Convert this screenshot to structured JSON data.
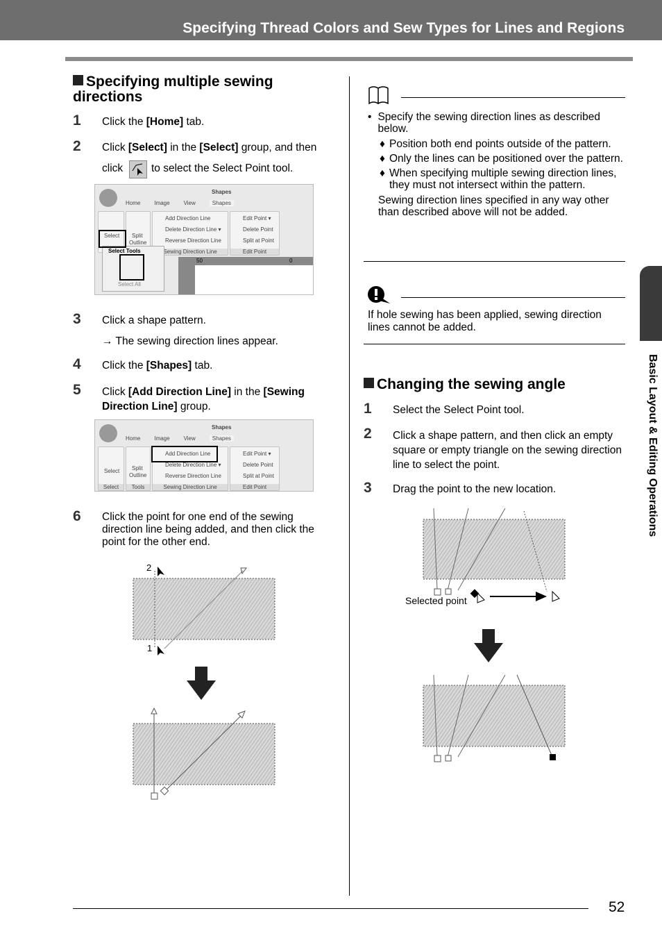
{
  "header": {
    "title": "Specifying Thread Colors and Sew Types for Lines and Regions"
  },
  "left": {
    "section_title": "Specifying multiple sewing directions",
    "steps": [
      {
        "num": "1",
        "pre": "Click the ",
        "b1": "[Home]",
        "post": " tab."
      },
      {
        "num": "2",
        "pre": "Click ",
        "b1": "[Select]",
        "mid": " in the ",
        "b2": "[Select]",
        "post": " group, and then",
        "line2a": "click",
        "line2b": "to select the Select Point tool."
      },
      {
        "num": "3",
        "text": "Click a shape pattern.",
        "result": "→ The sewing direction lines appear."
      },
      {
        "num": "4",
        "pre": "Click the ",
        "b1": "[Shapes]",
        "post": " tab."
      },
      {
        "num": "5",
        "pre": "Click ",
        "b1": "[Add Direction Line]",
        "mid": " in the ",
        "b2": "[Sewing Direction Line]",
        "post": " group."
      },
      {
        "num": "6",
        "text": "Click the point for one end of the sewing direction line being added, and then click the point for the other end."
      }
    ],
    "ribbon": {
      "qat_tab": "Shapes",
      "tabs": [
        "Home",
        "Image",
        "View",
        "Shapes"
      ],
      "select": "Select",
      "split": "Split",
      "outline": "Outline",
      "add": "Add Direction Line",
      "delete": "Delete Direction Line ▾",
      "reverse": "Reverse Direction Line",
      "group_sdl": "Sewing Direction Line",
      "edit_point": "Edit Point ▾",
      "delete_point": "Delete Point",
      "split_point": "Split at Point",
      "group_ep": "Edit Point",
      "group_select": "Select",
      "group_tools": "Tools",
      "select_tools": "Select Tools",
      "select_all": "Select All",
      "ruler_a": "50",
      "ruler_b": "0"
    },
    "diagram_labels": {
      "p2": "2",
      "p1": "1"
    }
  },
  "right": {
    "note_bullet": "Specify the sewing direction lines as described below.",
    "note_subs": [
      "Position both end points outside of the pattern.",
      "Only the lines can be positioned over the pattern.",
      "When specifying multiple sewing direction lines, they must not intersect within the pattern."
    ],
    "note_tail": "Sewing direction lines specified in any way other than described above will not be added.",
    "caution": "If hole sewing has been applied, sewing direction lines cannot be added.",
    "section_title": "Changing the sewing angle",
    "steps": [
      {
        "num": "1",
        "text": "Select the Select Point tool."
      },
      {
        "num": "2",
        "text": "Click a shape pattern, and then click an empty square or empty triangle on the sewing direction line to select the point."
      },
      {
        "num": "3",
        "text": "Drag the point to the new location."
      }
    ],
    "selected_point": "Selected point"
  },
  "side_tab": "Basic Layout & Editing Operations",
  "page_number": "52"
}
